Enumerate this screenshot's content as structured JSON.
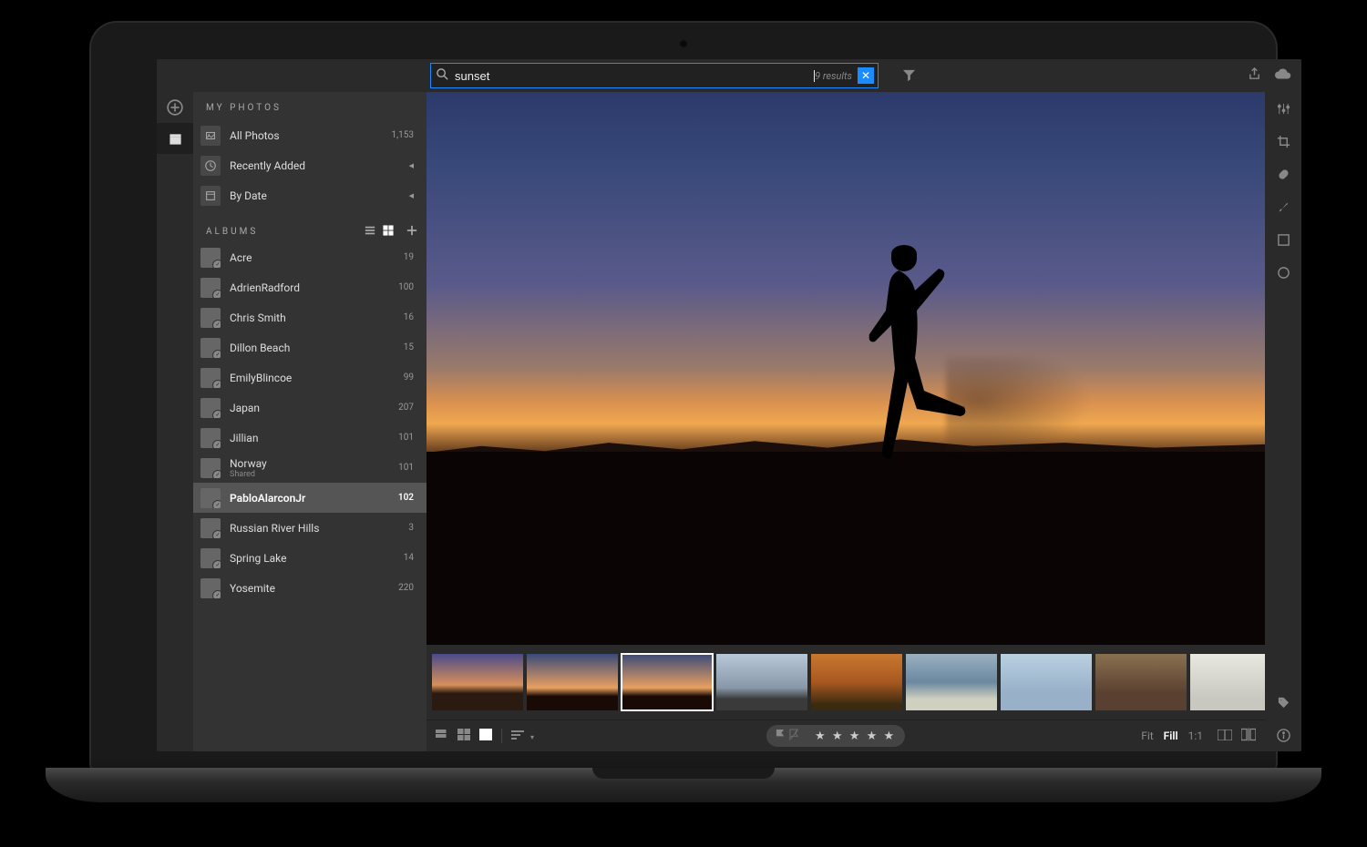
{
  "search": {
    "value": "sunset",
    "results_label": "9 results"
  },
  "sidebar": {
    "myphotos_title": "MY PHOTOS",
    "items": [
      {
        "label": "All Photos",
        "count": "1,153",
        "kind": "count"
      },
      {
        "label": "Recently Added",
        "kind": "chevron"
      },
      {
        "label": "By Date",
        "kind": "chevron"
      }
    ],
    "albums_title": "ALBUMS",
    "albums": [
      {
        "label": "Acre",
        "count": "19",
        "thumb": "th-acre"
      },
      {
        "label": "AdrienRadford",
        "count": "100",
        "thumb": "th-adr"
      },
      {
        "label": "Chris Smith",
        "count": "16",
        "thumb": "th-chris"
      },
      {
        "label": "Dillon Beach",
        "count": "15",
        "thumb": "th-dillon"
      },
      {
        "label": "EmilyBlincoe",
        "count": "99",
        "thumb": "th-emily"
      },
      {
        "label": "Japan",
        "count": "207",
        "thumb": "th-japan"
      },
      {
        "label": "Jillian",
        "count": "101",
        "thumb": "th-jill"
      },
      {
        "label": "Norway",
        "count": "101",
        "thumb": "th-norway",
        "sub": "Shared"
      },
      {
        "label": "PabloAlarconJr",
        "count": "102",
        "thumb": "th-pablo",
        "selected": true
      },
      {
        "label": "Russian River Hills",
        "count": "3",
        "thumb": "th-rr"
      },
      {
        "label": "Spring Lake",
        "count": "14",
        "thumb": "th-spring"
      },
      {
        "label": "Yosemite",
        "count": "220",
        "thumb": "th-yosemite"
      }
    ]
  },
  "filmstrip": {
    "selected_index": 2,
    "thumbs": [
      "sunset1",
      "sunset2",
      "sunset2",
      "people",
      "trees",
      "mtn",
      "jump",
      "rock",
      "beach"
    ]
  },
  "zoom": {
    "fit": "Fit",
    "fill": "Fill",
    "oneone": "1:1",
    "active": "fill"
  },
  "rating": "★ ★ ★ ★ ★"
}
